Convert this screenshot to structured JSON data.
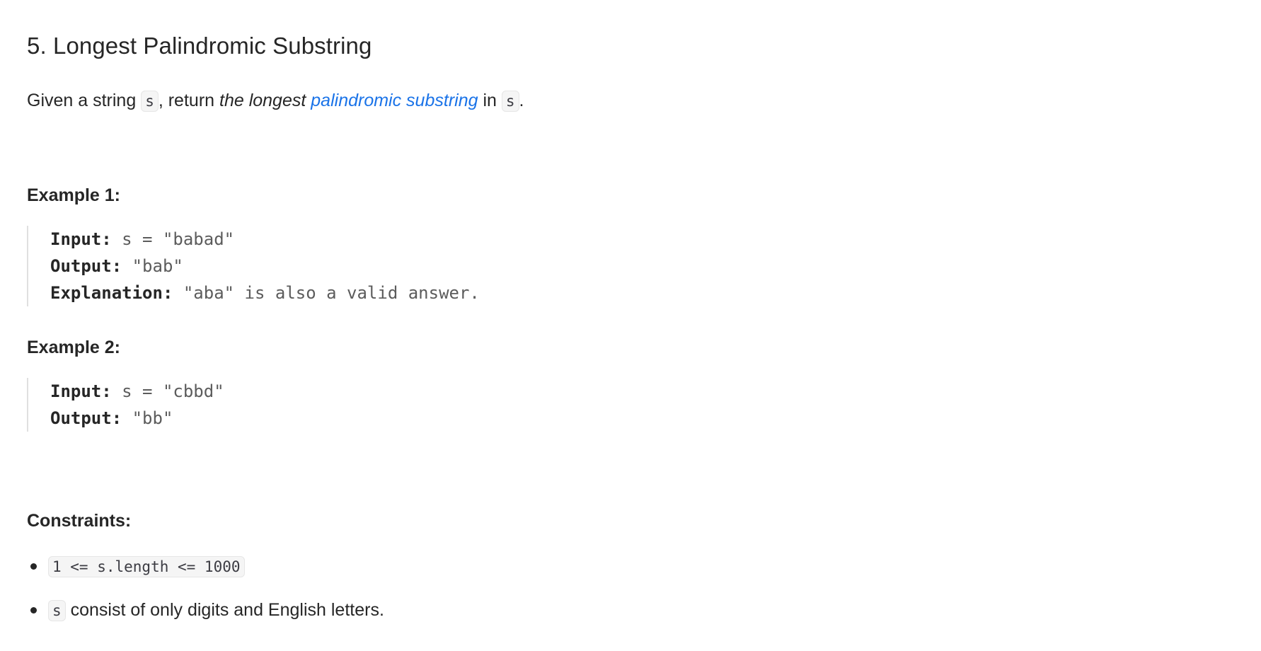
{
  "problem": {
    "title": "5. Longest Palindromic Substring",
    "description": {
      "part1": "Given a string ",
      "code1": "s",
      "part2": ", return ",
      "em": "the longest",
      "link": "palindromic substring",
      "part3": " in ",
      "code2": "s",
      "part4": "."
    }
  },
  "examples": [
    {
      "heading": "Example 1:",
      "input_label": "Input:",
      "input_value": " s = \"babad\"",
      "output_label": "Output:",
      "output_value": " \"bab\"",
      "explanation_label": "Explanation:",
      "explanation_value": " \"aba\" is also a valid answer."
    },
    {
      "heading": "Example 2:",
      "input_label": "Input:",
      "input_value": " s = \"cbbd\"",
      "output_label": "Output:",
      "output_value": " \"bb\""
    }
  ],
  "constraints": {
    "heading": "Constraints:",
    "items": [
      {
        "code": "1 <= s.length <= 1000",
        "text": ""
      },
      {
        "code": "s",
        "text": " consist of only digits and English letters."
      }
    ]
  }
}
